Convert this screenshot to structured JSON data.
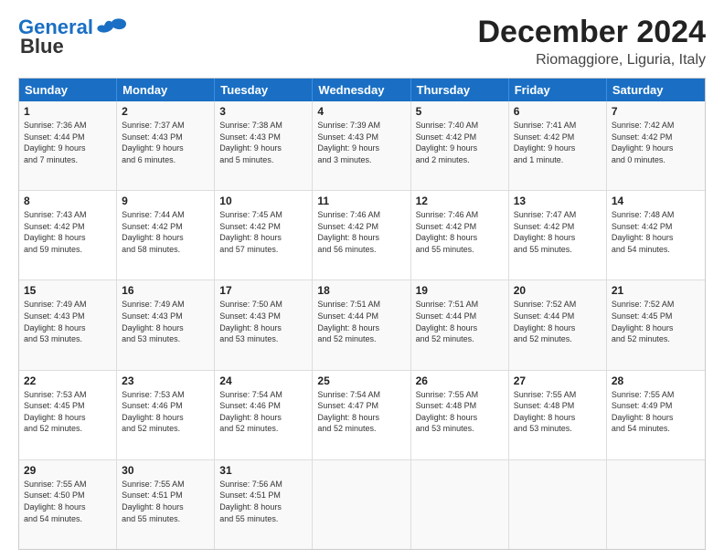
{
  "header": {
    "logo_line1": "General",
    "logo_line2": "Blue",
    "title": "December 2024",
    "subtitle": "Riomaggiore, Liguria, Italy"
  },
  "calendar": {
    "headers": [
      "Sunday",
      "Monday",
      "Tuesday",
      "Wednesday",
      "Thursday",
      "Friday",
      "Saturday"
    ],
    "rows": [
      [
        {
          "day": "1",
          "lines": [
            "Sunrise: 7:36 AM",
            "Sunset: 4:44 PM",
            "Daylight: 9 hours",
            "and 7 minutes."
          ]
        },
        {
          "day": "2",
          "lines": [
            "Sunrise: 7:37 AM",
            "Sunset: 4:43 PM",
            "Daylight: 9 hours",
            "and 6 minutes."
          ]
        },
        {
          "day": "3",
          "lines": [
            "Sunrise: 7:38 AM",
            "Sunset: 4:43 PM",
            "Daylight: 9 hours",
            "and 5 minutes."
          ]
        },
        {
          "day": "4",
          "lines": [
            "Sunrise: 7:39 AM",
            "Sunset: 4:43 PM",
            "Daylight: 9 hours",
            "and 3 minutes."
          ]
        },
        {
          "day": "5",
          "lines": [
            "Sunrise: 7:40 AM",
            "Sunset: 4:42 PM",
            "Daylight: 9 hours",
            "and 2 minutes."
          ]
        },
        {
          "day": "6",
          "lines": [
            "Sunrise: 7:41 AM",
            "Sunset: 4:42 PM",
            "Daylight: 9 hours",
            "and 1 minute."
          ]
        },
        {
          "day": "7",
          "lines": [
            "Sunrise: 7:42 AM",
            "Sunset: 4:42 PM",
            "Daylight: 9 hours",
            "and 0 minutes."
          ]
        }
      ],
      [
        {
          "day": "8",
          "lines": [
            "Sunrise: 7:43 AM",
            "Sunset: 4:42 PM",
            "Daylight: 8 hours",
            "and 59 minutes."
          ]
        },
        {
          "day": "9",
          "lines": [
            "Sunrise: 7:44 AM",
            "Sunset: 4:42 PM",
            "Daylight: 8 hours",
            "and 58 minutes."
          ]
        },
        {
          "day": "10",
          "lines": [
            "Sunrise: 7:45 AM",
            "Sunset: 4:42 PM",
            "Daylight: 8 hours",
            "and 57 minutes."
          ]
        },
        {
          "day": "11",
          "lines": [
            "Sunrise: 7:46 AM",
            "Sunset: 4:42 PM",
            "Daylight: 8 hours",
            "and 56 minutes."
          ]
        },
        {
          "day": "12",
          "lines": [
            "Sunrise: 7:46 AM",
            "Sunset: 4:42 PM",
            "Daylight: 8 hours",
            "and 55 minutes."
          ]
        },
        {
          "day": "13",
          "lines": [
            "Sunrise: 7:47 AM",
            "Sunset: 4:42 PM",
            "Daylight: 8 hours",
            "and 55 minutes."
          ]
        },
        {
          "day": "14",
          "lines": [
            "Sunrise: 7:48 AM",
            "Sunset: 4:42 PM",
            "Daylight: 8 hours",
            "and 54 minutes."
          ]
        }
      ],
      [
        {
          "day": "15",
          "lines": [
            "Sunrise: 7:49 AM",
            "Sunset: 4:43 PM",
            "Daylight: 8 hours",
            "and 53 minutes."
          ]
        },
        {
          "day": "16",
          "lines": [
            "Sunrise: 7:49 AM",
            "Sunset: 4:43 PM",
            "Daylight: 8 hours",
            "and 53 minutes."
          ]
        },
        {
          "day": "17",
          "lines": [
            "Sunrise: 7:50 AM",
            "Sunset: 4:43 PM",
            "Daylight: 8 hours",
            "and 53 minutes."
          ]
        },
        {
          "day": "18",
          "lines": [
            "Sunrise: 7:51 AM",
            "Sunset: 4:44 PM",
            "Daylight: 8 hours",
            "and 52 minutes."
          ]
        },
        {
          "day": "19",
          "lines": [
            "Sunrise: 7:51 AM",
            "Sunset: 4:44 PM",
            "Daylight: 8 hours",
            "and 52 minutes."
          ]
        },
        {
          "day": "20",
          "lines": [
            "Sunrise: 7:52 AM",
            "Sunset: 4:44 PM",
            "Daylight: 8 hours",
            "and 52 minutes."
          ]
        },
        {
          "day": "21",
          "lines": [
            "Sunrise: 7:52 AM",
            "Sunset: 4:45 PM",
            "Daylight: 8 hours",
            "and 52 minutes."
          ]
        }
      ],
      [
        {
          "day": "22",
          "lines": [
            "Sunrise: 7:53 AM",
            "Sunset: 4:45 PM",
            "Daylight: 8 hours",
            "and 52 minutes."
          ]
        },
        {
          "day": "23",
          "lines": [
            "Sunrise: 7:53 AM",
            "Sunset: 4:46 PM",
            "Daylight: 8 hours",
            "and 52 minutes."
          ]
        },
        {
          "day": "24",
          "lines": [
            "Sunrise: 7:54 AM",
            "Sunset: 4:46 PM",
            "Daylight: 8 hours",
            "and 52 minutes."
          ]
        },
        {
          "day": "25",
          "lines": [
            "Sunrise: 7:54 AM",
            "Sunset: 4:47 PM",
            "Daylight: 8 hours",
            "and 52 minutes."
          ]
        },
        {
          "day": "26",
          "lines": [
            "Sunrise: 7:55 AM",
            "Sunset: 4:48 PM",
            "Daylight: 8 hours",
            "and 53 minutes."
          ]
        },
        {
          "day": "27",
          "lines": [
            "Sunrise: 7:55 AM",
            "Sunset: 4:48 PM",
            "Daylight: 8 hours",
            "and 53 minutes."
          ]
        },
        {
          "day": "28",
          "lines": [
            "Sunrise: 7:55 AM",
            "Sunset: 4:49 PM",
            "Daylight: 8 hours",
            "and 54 minutes."
          ]
        }
      ],
      [
        {
          "day": "29",
          "lines": [
            "Sunrise: 7:55 AM",
            "Sunset: 4:50 PM",
            "Daylight: 8 hours",
            "and 54 minutes."
          ]
        },
        {
          "day": "30",
          "lines": [
            "Sunrise: 7:55 AM",
            "Sunset: 4:51 PM",
            "Daylight: 8 hours",
            "and 55 minutes."
          ]
        },
        {
          "day": "31",
          "lines": [
            "Sunrise: 7:56 AM",
            "Sunset: 4:51 PM",
            "Daylight: 8 hours",
            "and 55 minutes."
          ]
        },
        {
          "day": "",
          "lines": []
        },
        {
          "day": "",
          "lines": []
        },
        {
          "day": "",
          "lines": []
        },
        {
          "day": "",
          "lines": []
        }
      ]
    ]
  }
}
